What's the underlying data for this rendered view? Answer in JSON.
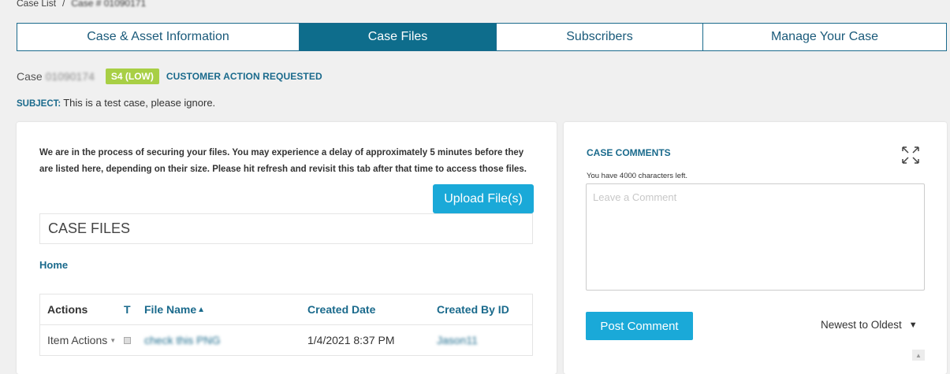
{
  "breadcrumb": {
    "root": "Case List",
    "separator": "/",
    "current": "Case # 01090171"
  },
  "tabs": [
    {
      "label": "Case & Asset Information",
      "active": false
    },
    {
      "label": "Case Files",
      "active": true
    },
    {
      "label": "Subscribers",
      "active": false
    },
    {
      "label": "Manage Your Case",
      "active": false
    }
  ],
  "case": {
    "prefix": "Case",
    "number_masked": " 01090174",
    "severity": "S4 (LOW)",
    "status": "CUSTOMER ACTION REQUESTED",
    "subject_label": "SUBJECT:",
    "subject": "This is a test case, please ignore."
  },
  "files": {
    "notice": "We are in the process of securing your files. You may experience a delay of approximately 5 minutes before they are listed here, depending on their size. Please hit refresh and revisit this tab after that time to access those files.",
    "upload_label": "Upload File(s)",
    "section_title": "CASE FILES",
    "home_link": "Home",
    "columns": {
      "actions": "Actions",
      "type": "T",
      "name": "File Name",
      "name_sort": "▲",
      "created_date": "Created Date",
      "created_by": "Created By ID"
    },
    "rows": [
      {
        "actions": "Item Actions",
        "name": "check this PNG",
        "created_date": "1/4/2021 8:37 PM",
        "created_by": "Jason11"
      }
    ]
  },
  "comments": {
    "title": "CASE COMMENTS",
    "chars_left": "You have 4000 characters left.",
    "placeholder": "Leave a Comment",
    "post_label": "Post Comment",
    "sort_label": "Newest to Oldest",
    "sort_caret": "▼"
  },
  "colors": {
    "accent": "#0e6d8c",
    "button": "#1aa9d8",
    "severity": "#a8cf45"
  }
}
